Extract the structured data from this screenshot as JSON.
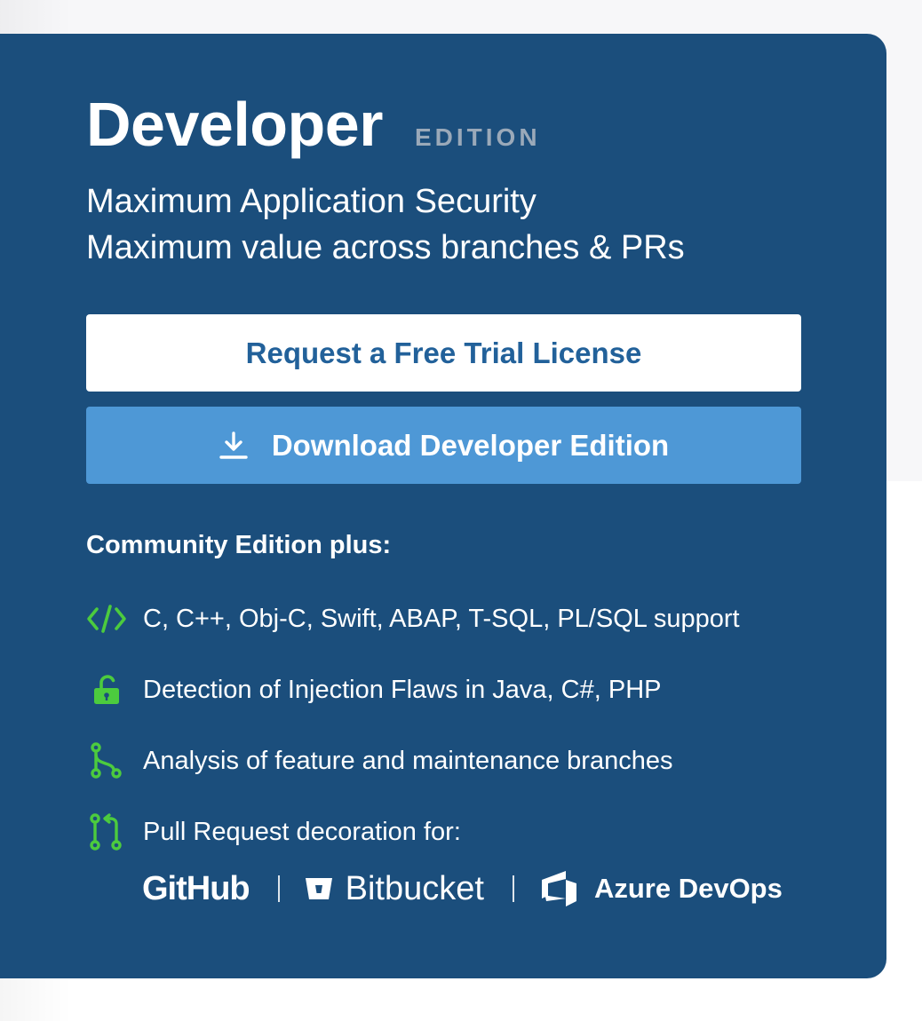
{
  "card": {
    "title": "Developer",
    "edition_tag": "EDITION",
    "subtitle_line1": "Maximum Application Security",
    "subtitle_line2": "Maximum value across branches & PRs"
  },
  "buttons": {
    "trial_label": "Request a Free Trial License",
    "download_label": "Download Developer Edition"
  },
  "features": {
    "heading": "Community Edition plus:",
    "items": [
      {
        "icon": "code-icon",
        "text": "C, C++, Obj-C, Swift, ABAP, T-SQL, PL/SQL support"
      },
      {
        "icon": "unlock-icon",
        "text": "Detection of Injection Flaws in Java, C#, PHP"
      },
      {
        "icon": "branch-icon",
        "text": "Analysis of feature and maintenance branches"
      },
      {
        "icon": "pull-request-icon",
        "text": "Pull Request decoration for:"
      }
    ]
  },
  "platforms": {
    "github": "GitHub",
    "bitbucket": "Bitbucket",
    "azure": "Azure DevOps"
  },
  "colors": {
    "card_bg": "#1b4e7c",
    "trial_text": "#22619a",
    "download_bg": "#4e98d6",
    "icon_green": "#4ccb3e",
    "edition_gray": "#9aa9b9"
  }
}
